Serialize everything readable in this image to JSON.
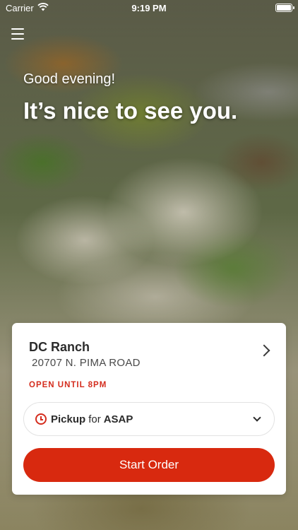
{
  "status_bar": {
    "carrier": "Carrier",
    "time": "9:19 PM"
  },
  "hero": {
    "greeting": "Good evening!",
    "headline": "It’s nice to see you."
  },
  "location": {
    "name": "DC Ranch",
    "address": "20707 N. PIMA ROAD",
    "open_status": "OPEN UNTIL 8PM"
  },
  "order_mode": {
    "mode": "Pickup",
    "connector": "for",
    "time": "ASAP"
  },
  "actions": {
    "start_order_label": "Start Order"
  },
  "colors": {
    "accent": "#d8290f",
    "status_red": "#d42c1d"
  },
  "icons": [
    "wifi-icon",
    "battery-icon",
    "menu-icon",
    "chevron-right-icon",
    "clock-icon",
    "chevron-down-icon"
  ]
}
